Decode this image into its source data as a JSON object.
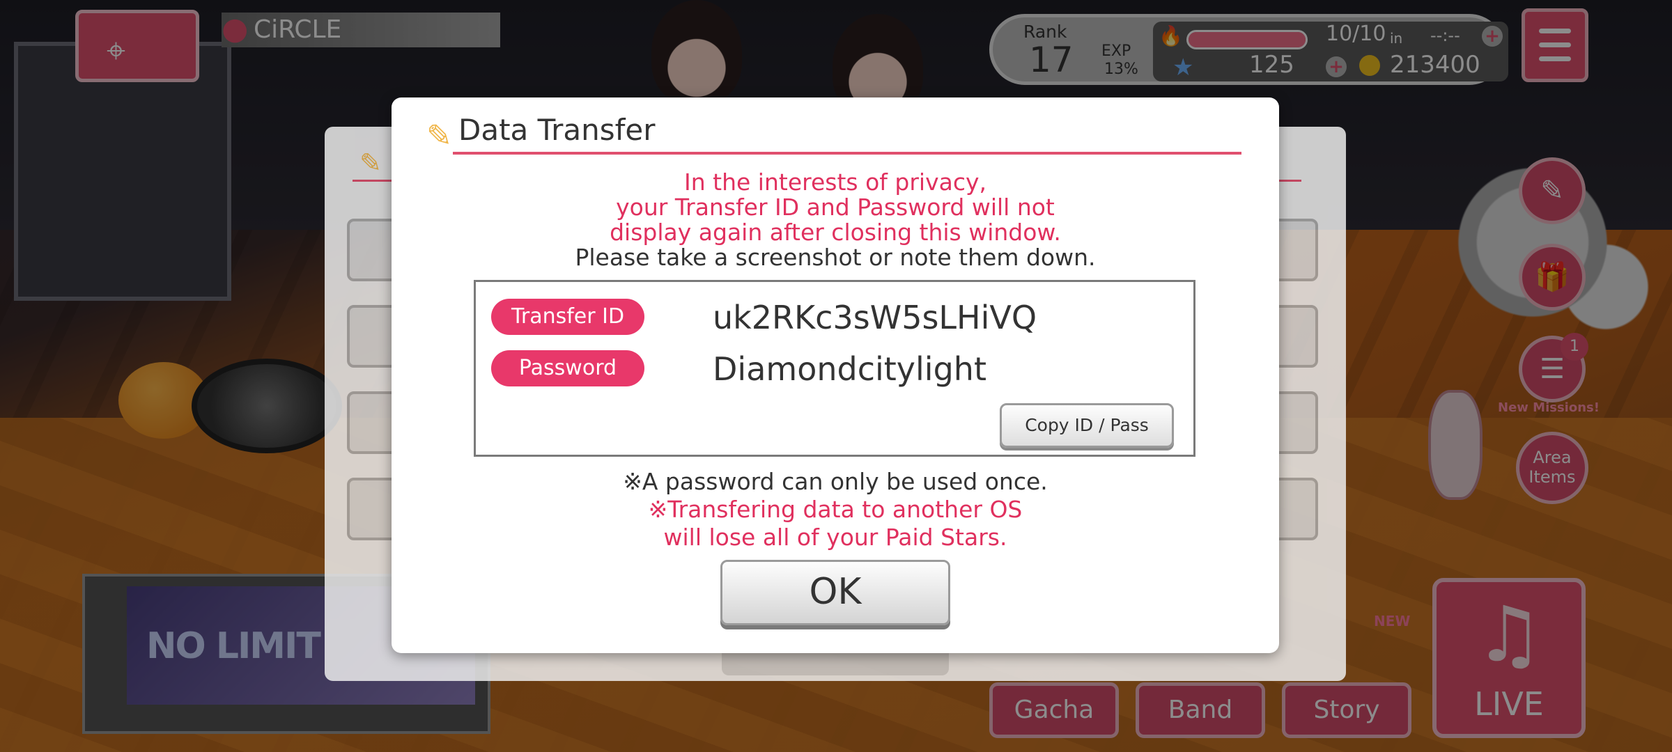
{
  "hud": {
    "location": "CiRCLE",
    "rank_label": "Rank",
    "rank": "17",
    "exp_label": "EXP",
    "exp_percent": "13%",
    "stamina": "10/10",
    "stamina_fraction": 1.0,
    "stamina_in_label": "in",
    "stamina_timer": "--:--",
    "stars": "125",
    "coins": "213400"
  },
  "side": {
    "missions_label": "New Missions!",
    "missions_badge": "1",
    "area_items_line1": "Area",
    "area_items_line2": "Items"
  },
  "bottom": {
    "gacha": "Gacha",
    "band": "Band",
    "story": "Story",
    "new_tag": "NEW",
    "live": "LIVE",
    "event_title": "NO LIMIT"
  },
  "dialog": {
    "title": "Data Transfer",
    "privacy_notice": [
      "In the interests of privacy,",
      "your Transfer ID and Password will not",
      "display again after closing this window."
    ],
    "screenshot_hint": "Please take a screenshot or note them down.",
    "transfer_id_label": "Transfer ID",
    "transfer_id": "uk2RKc3sW5sLHiVQ",
    "password_label": "Password",
    "password": "Diamondcitylight",
    "copy_button": "Copy ID / Pass",
    "once_notice": "※A password can only be used once.",
    "os_warning": [
      "※Transfering data to another OS",
      "will lose all of your Paid Stars."
    ],
    "ok_button": "OK"
  },
  "colors": {
    "accent": "#e0506e",
    "warning_text": "#e0305e"
  },
  "icons": [
    "pin-icon",
    "fire-icon",
    "star-icon",
    "coin-icon",
    "plus-icon",
    "menu-icon",
    "pen-icon",
    "gift-icon",
    "missions-icon",
    "music-note-icon"
  ]
}
